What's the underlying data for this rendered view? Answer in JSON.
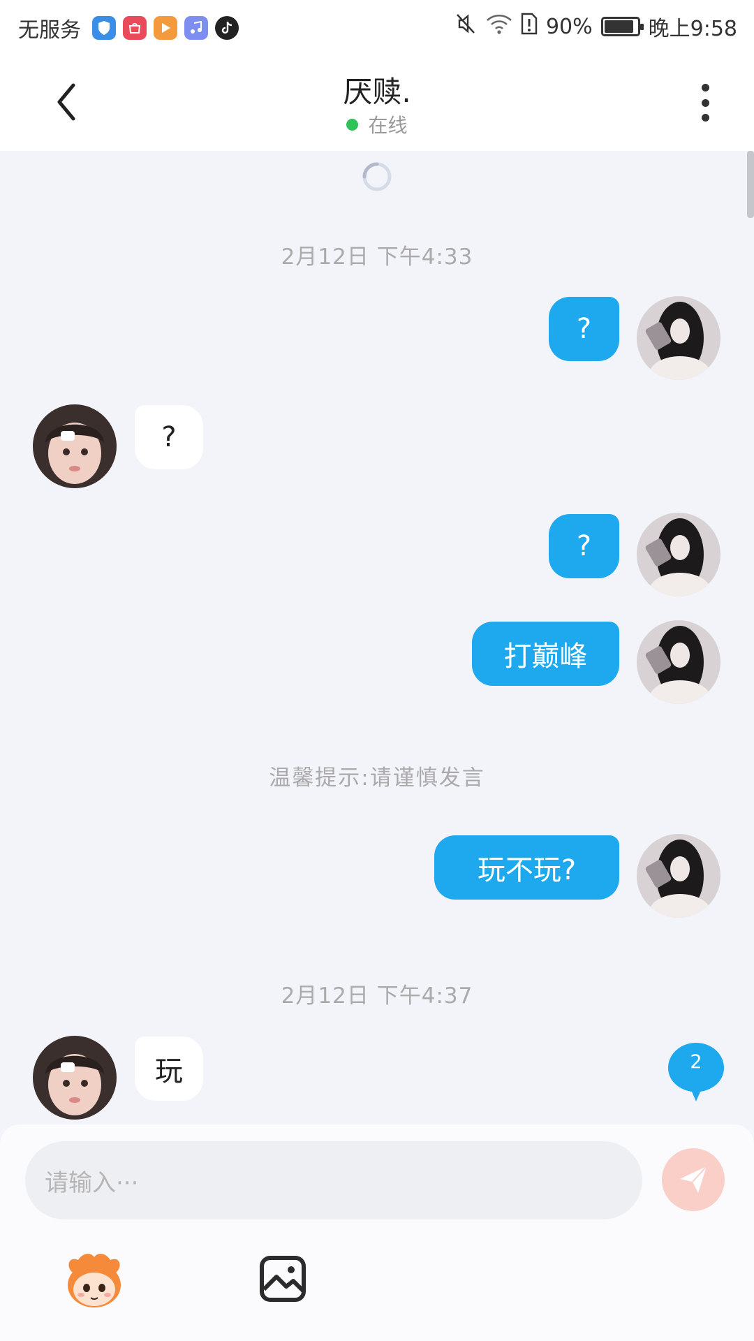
{
  "status_bar": {
    "carrier": "无服务",
    "battery_text": "90%",
    "battery_level": 0.9,
    "time": "晚上9:58",
    "app_icons": [
      "shield-app-icon",
      "huawei-store-icon",
      "video-app-icon",
      "music-app-icon",
      "tiktok-icon"
    ]
  },
  "header": {
    "title": "厌赎.",
    "status": "在线",
    "status_color": "#30c35a"
  },
  "chat": {
    "timestamps": [
      "2月12日  下午4:33",
      "2月12日  下午4:37"
    ],
    "hint": "温馨提示:请谨慎发言",
    "messages": [
      {
        "from": "me",
        "text": "?"
      },
      {
        "from": "them",
        "text": "?"
      },
      {
        "from": "me",
        "text": "?"
      },
      {
        "from": "me",
        "text": "打巅峰"
      },
      {
        "from": "me",
        "text": "玩不玩?"
      },
      {
        "from": "them",
        "text": "玩"
      }
    ],
    "unread_count": "2"
  },
  "composer": {
    "placeholder": "请输入···"
  },
  "colors": {
    "my_bubble": "#1ea9ef",
    "their_bubble": "#ffffff",
    "chat_background": "#f2f4fa",
    "send_button": "#f9cfc7"
  }
}
